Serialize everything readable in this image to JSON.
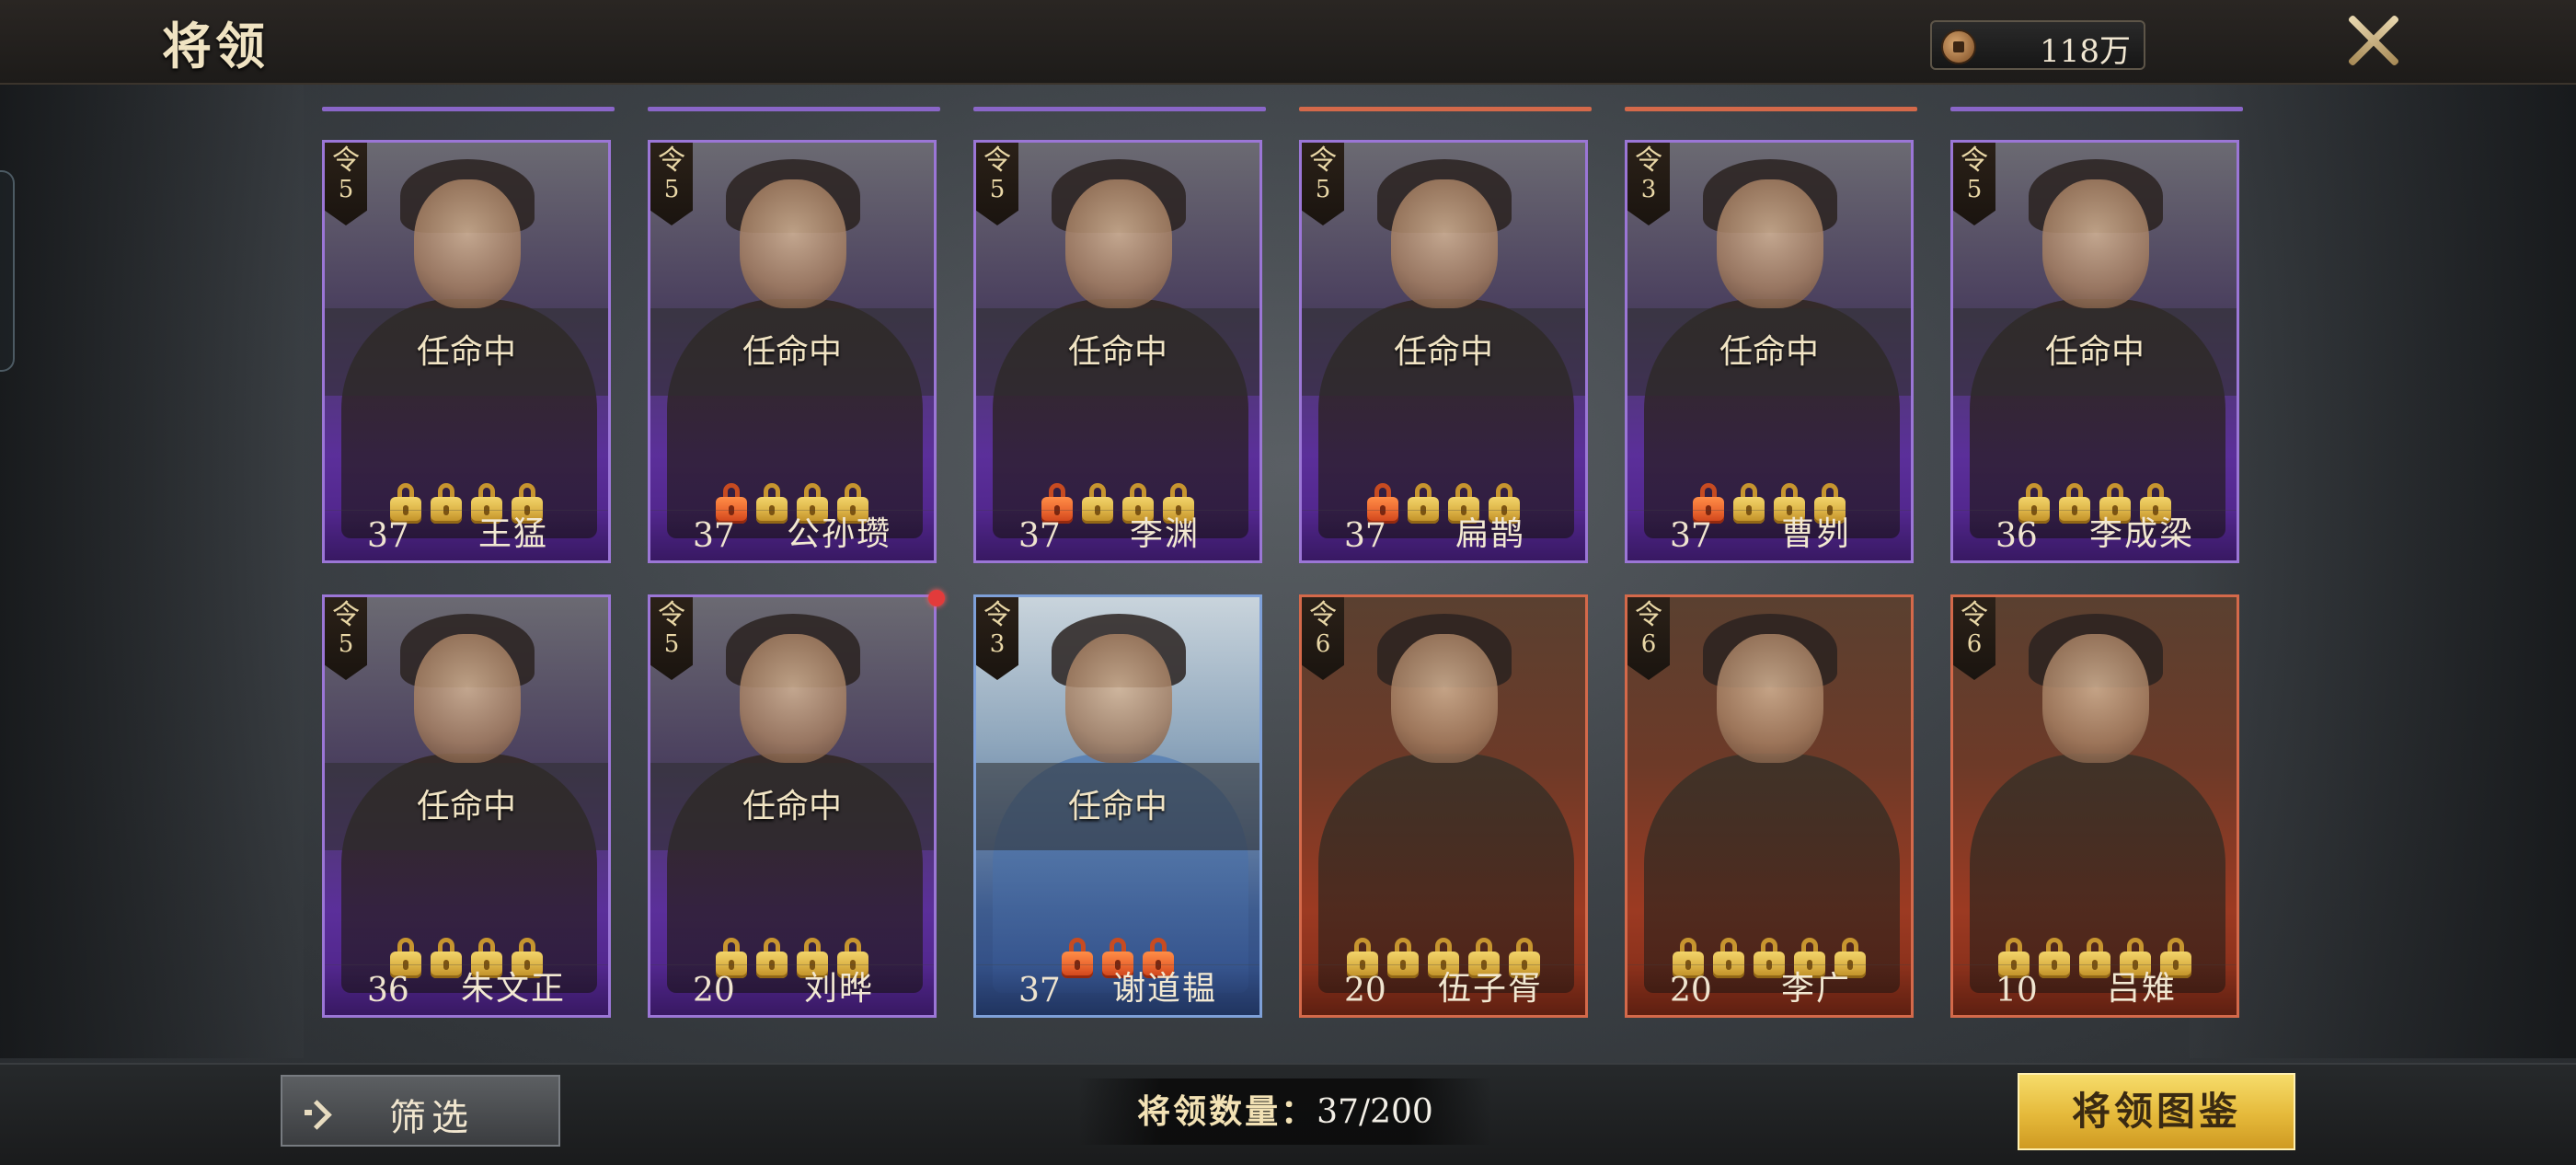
{
  "header": {
    "title": "将领",
    "currency_value": "118万"
  },
  "cards": [
    {
      "rank_label": "令",
      "rank": "5",
      "status": "任命中",
      "level": "37",
      "name": "王猛",
      "rarity": "purple",
      "locks": [
        "gold",
        "gold",
        "gold",
        "gold"
      ]
    },
    {
      "rank_label": "令",
      "rank": "5",
      "status": "任命中",
      "level": "37",
      "name": "公孙瓒",
      "rarity": "purple",
      "locks": [
        "red",
        "gold",
        "gold",
        "gold"
      ]
    },
    {
      "rank_label": "令",
      "rank": "5",
      "status": "任命中",
      "level": "37",
      "name": "李渊",
      "rarity": "purple",
      "locks": [
        "red",
        "gold",
        "gold",
        "gold"
      ]
    },
    {
      "rank_label": "令",
      "rank": "5",
      "status": "任命中",
      "level": "37",
      "name": "扁鹊",
      "rarity": "purple",
      "locks": [
        "red",
        "gold",
        "gold",
        "gold"
      ]
    },
    {
      "rank_label": "令",
      "rank": "3",
      "status": "任命中",
      "level": "37",
      "name": "曹刿",
      "rarity": "purple",
      "locks": [
        "red",
        "gold",
        "gold",
        "gold"
      ]
    },
    {
      "rank_label": "令",
      "rank": "5",
      "status": "任命中",
      "level": "36",
      "name": "李成梁",
      "rarity": "purple",
      "locks": [
        "gold",
        "gold",
        "gold",
        "gold"
      ]
    },
    {
      "rank_label": "令",
      "rank": "5",
      "status": "任命中",
      "level": "36",
      "name": "朱文正",
      "rarity": "purple",
      "locks": [
        "gold",
        "gold",
        "gold",
        "gold"
      ]
    },
    {
      "rank_label": "令",
      "rank": "5",
      "status": "任命中",
      "level": "20",
      "name": "刘晔",
      "rarity": "purple",
      "locks": [
        "gold",
        "gold",
        "gold",
        "gold"
      ]
    },
    {
      "rank_label": "令",
      "rank": "3",
      "status": "任命中",
      "level": "37",
      "name": "谢道韫",
      "rarity": "blue",
      "locks": [
        "red",
        "red",
        "red"
      ]
    },
    {
      "rank_label": "令",
      "rank": "6",
      "status": "",
      "level": "20",
      "name": "伍子胥",
      "rarity": "orange",
      "locks": [
        "gold",
        "gold",
        "gold",
        "gold",
        "gold"
      ]
    },
    {
      "rank_label": "令",
      "rank": "6",
      "status": "",
      "level": "20",
      "name": "李广",
      "rarity": "orange",
      "locks": [
        "gold",
        "gold",
        "gold",
        "gold",
        "gold"
      ]
    },
    {
      "rank_label": "令",
      "rank": "6",
      "status": "",
      "level": "10",
      "name": "吕雉",
      "rarity": "orange",
      "locks": [
        "gold",
        "gold",
        "gold",
        "gold",
        "gold"
      ]
    }
  ],
  "footer": {
    "filter_label": "筛选",
    "count_label": "将领数量：",
    "count_value": "37/200",
    "codex_label": "将领图鉴"
  },
  "colors": {
    "purple": "#9b76d6",
    "blue": "#7ea0d8",
    "orange": "#d4694a",
    "accent_gold": "#e5b93a"
  }
}
